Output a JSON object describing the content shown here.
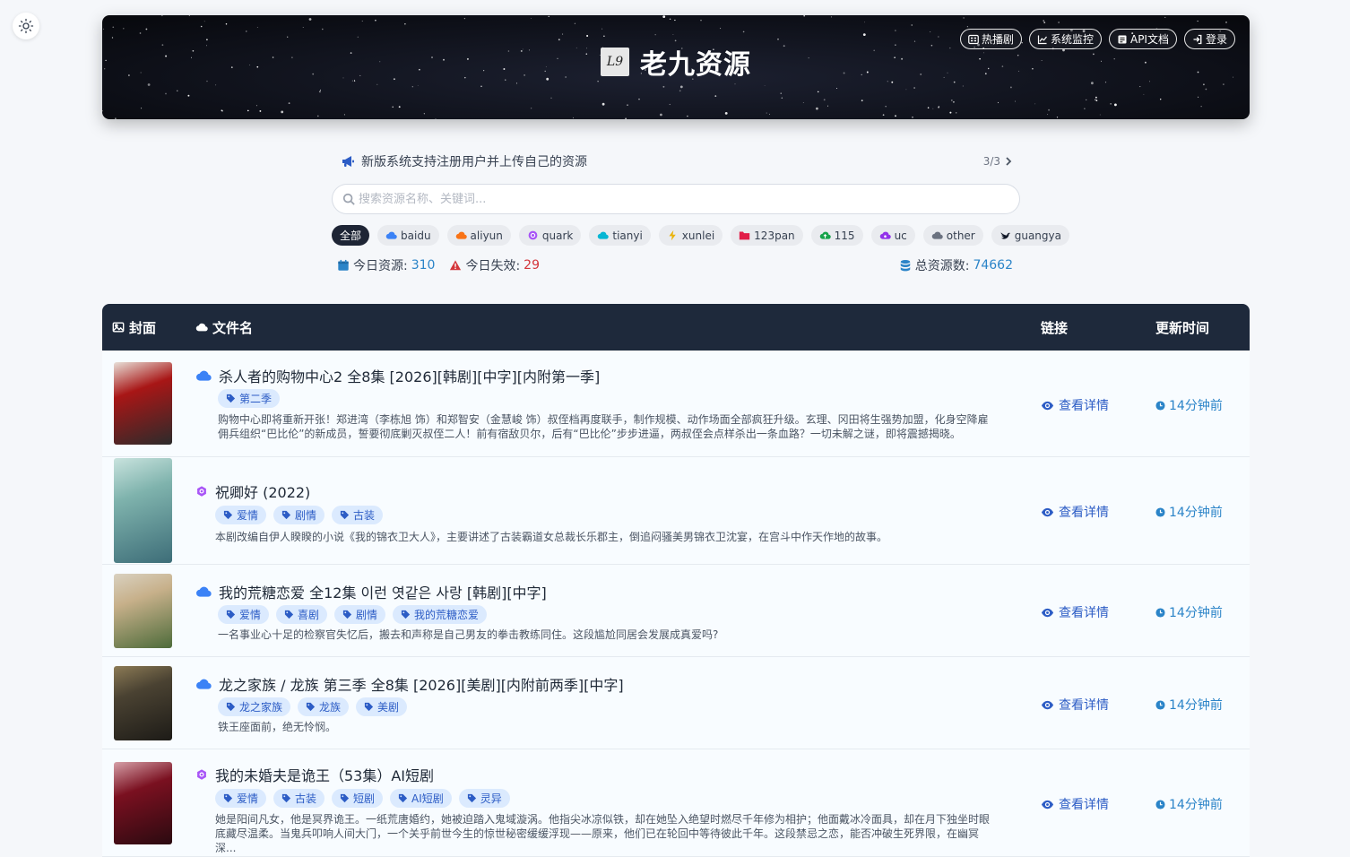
{
  "header": {
    "logo_text": "L9",
    "title": "老九资源",
    "nav": [
      {
        "label": "热播剧",
        "icon": "grid-icon"
      },
      {
        "label": "系统监控",
        "icon": "chart-icon"
      },
      {
        "label": "API文档",
        "icon": "doc-icon"
      },
      {
        "label": "登录",
        "icon": "login-icon"
      }
    ]
  },
  "notice": {
    "text": "新版系统支持注册用户并上传自己的资源",
    "pager": "3/3"
  },
  "search": {
    "placeholder": "搜索资源名称、关键词..."
  },
  "filters": [
    {
      "label": "全部",
      "active": true
    },
    {
      "label": "baidu",
      "color": "#3b82f6"
    },
    {
      "label": "aliyun",
      "color": "#f97316"
    },
    {
      "label": "quark",
      "color": "#a855f7"
    },
    {
      "label": "tianyi",
      "color": "#06b6d4"
    },
    {
      "label": "xunlei",
      "color": "#eab308"
    },
    {
      "label": "123pan",
      "color": "#e11d48"
    },
    {
      "label": "115",
      "color": "#16a34a"
    },
    {
      "label": "uc",
      "color": "#9333ea"
    },
    {
      "label": "other",
      "color": "#6b7280"
    },
    {
      "label": "guangya",
      "color": "#111827"
    }
  ],
  "stats": {
    "today_label": "今日资源:",
    "today_value": "310",
    "fail_label": "今日失效:",
    "fail_value": "29",
    "total_label": "总资源数:",
    "total_value": "74662"
  },
  "table": {
    "headers": {
      "cover": "封面",
      "name": "文件名",
      "link": "链接",
      "time": "更新时间"
    },
    "detail_label": "查看详情",
    "rows": [
      {
        "source": "cloud",
        "title": "杀人者的购物中心2 全8集 [2026][韩剧][中字][内附第一季]",
        "tags": [
          "第二季"
        ],
        "desc": "购物中心即将重新开张！郑进湾（李栋旭 饰）和郑智安（金慧峻 饰）叔侄档再度联手，制作规模、动作场面全部疯狂升级。玄理、冈田将生强势加盟，化身空降雇佣兵组织“巴比伦”的新成员，誓要彻底剿灭叔侄二人！前有宿敌贝尔，后有“巴比伦”步步进逼，两叔侄会点样杀出一条血路？一切未解之谜，即将震撼揭晓。",
        "time": "14分钟前",
        "cover_colors": [
          "#a81616",
          "#2b2b2b",
          "#e8e0d8"
        ]
      },
      {
        "source": "quark",
        "title": "祝卿好 (2022)",
        "tags": [
          "爱情",
          "剧情",
          "古装"
        ],
        "desc": "本剧改编自伊人睽睽的小说《我的锦衣卫大人》，主要讲述了古装霸道女总裁长乐郡主，倒追闷骚美男锦衣卫沈宴，在宫斗中作天作地的故事。",
        "time": "14分钟前",
        "cover_colors": [
          "#7fb3ad",
          "#3d6d78",
          "#c9e3de"
        ]
      },
      {
        "source": "cloud",
        "title": "我的荒糖恋爱 全12集 이런 엿같은 사랑 [韩剧][中字]",
        "tags": [
          "爱情",
          "喜剧",
          "剧情",
          "我的荒糖恋爱"
        ],
        "desc": "一名事业心十足的检察官失忆后，搬去和声称是自己男友的拳击教练同住。这段尴尬同居会发展成真爱吗?",
        "time": "14分钟前",
        "cover_colors": [
          "#c7b08a",
          "#4d6b3a",
          "#d9d1c0"
        ]
      },
      {
        "source": "cloud",
        "title": "龙之家族 / 龙族 第三季 全8集 [2026][美剧][内附前两季][中字]",
        "tags": [
          "龙之家族",
          "龙族",
          "美剧"
        ],
        "desc": "铁王座面前，绝无怜悯。",
        "time": "14分钟前",
        "cover_colors": [
          "#4a4232",
          "#1d1b17",
          "#8c7b56"
        ]
      },
      {
        "source": "quark",
        "title": "我的未婚夫是诡王（53集）AI短剧",
        "tags": [
          "爱情",
          "古装",
          "短剧",
          "AI短剧",
          "灵异"
        ],
        "desc": "她是阳间凡女，他是冥界诡王。一纸荒唐婚约，她被迫踏入鬼域漩涡。他指尖冰凉似铁，却在她坠入绝望时燃尽千年修为相护；他面戴冰冷面具，却在月下独坐时眼底藏尽温柔。当鬼兵叩响人间大门，一个关乎前世今生的惊世秘密缓缓浮现——原来，他们已在轮回中等待彼此千年。这段禁忌之恋，能否冲破生死界限，在幽冥深...",
        "time": "14分钟前",
        "cover_colors": [
          "#7a1020",
          "#2a0a10",
          "#d6a0a8"
        ]
      }
    ]
  }
}
